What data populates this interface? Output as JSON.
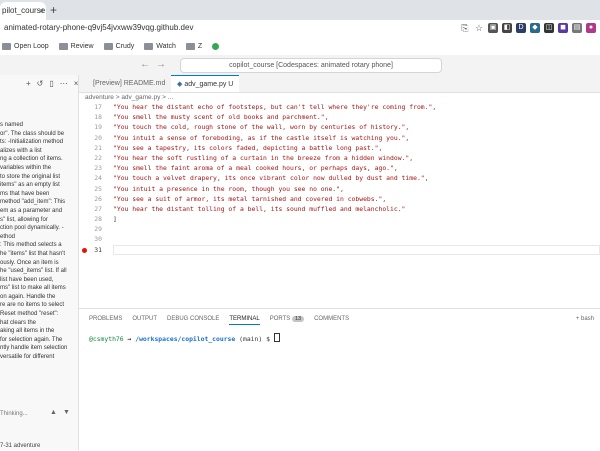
{
  "browser": {
    "tab_title": "pilot_course",
    "url": "animated-rotary-phone-q9vj54jvxww39vqg.github.dev",
    "bookmarks": [
      "Open Loop",
      "Review",
      "Crudy",
      "Watch",
      "Z"
    ]
  },
  "codespace": {
    "title": "copilot_course [Codespaces: animated rotary phone]",
    "tabs": [
      "[Preview] README.md",
      "adv_game.py U"
    ],
    "breadcrumb": "adventure  >  adv_game.py  >  ...",
    "code_lines": [
      {
        "n": "17",
        "text": "\"You hear the distant echo of footsteps, but can't tell where they're coming from.\","
      },
      {
        "n": "18",
        "text": "\"You smell the musty scent of old books and parchment.\","
      },
      {
        "n": "19",
        "text": "\"You touch the cold, rough stone of the wall, worn by centuries of history.\","
      },
      {
        "n": "20",
        "text": "\"You intuit a sense of foreboding, as if the castle itself is watching you.\","
      },
      {
        "n": "21",
        "text": "\"You see a tapestry, its colors faded, depicting a battle long past.\","
      },
      {
        "n": "22",
        "text": "\"You hear the soft rustling of a curtain in the breeze from a hidden window.\","
      },
      {
        "n": "23",
        "text": "\"You smell the faint aroma of a meal cooked hours, or perhaps days, ago.\","
      },
      {
        "n": "24",
        "text": "\"You touch a velvet drapery, its once vibrant color now dulled by dust and time.\","
      },
      {
        "n": "25",
        "text": "\"You intuit a presence in the room, though you see no one.\","
      },
      {
        "n": "26",
        "text": "\"You see a suit of armor, its metal tarnished and covered in cobwebs.\","
      },
      {
        "n": "27",
        "text": "\"You hear the distant tolling of a bell, its sound muffled and melancholic.\""
      },
      {
        "n": "28",
        "text": "]"
      },
      {
        "n": "29",
        "text": ""
      },
      {
        "n": "30",
        "text": ""
      },
      {
        "n": "31",
        "text": ""
      }
    ],
    "panel_tabs": [
      "PROBLEMS",
      "OUTPUT",
      "DEBUG CONSOLE",
      "TERMINAL",
      "PORTS",
      "COMMENTS"
    ],
    "ports_count": "13",
    "panel_right": "bash",
    "terminal": {
      "user": "@csmyth76",
      "arrow": "→",
      "path": "/workspaces/copilot_course",
      "branch": "(main)",
      "prompt": "$"
    }
  },
  "chat_panel": {
    "lines": [
      "s named",
      "or\". The class should be",
      "ts: -Initialization method",
      "alizes with a list",
      "ng a collection of items.",
      "variables within the",
      "to store the original list",
      "items\" as an empty list",
      "ms that have been",
      "method \"add_item\": This",
      "em as a parameter and",
      "s\" list, allowing for",
      "ction pool dynamically. -",
      "ethod",
      ": This method selects a",
      "he \"items\" list that hasn't",
      "ously. Once an item is",
      "he \"used_items\" list. If all",
      "list have been used,",
      "ms\" list to make all items",
      "on again. Handle the",
      "re are no items to select",
      "Reset method \"reset\":",
      "hat clears the",
      "aking all items in the",
      "for selection again. The",
      "ntly handle item selection",
      "versatile for different"
    ],
    "status": "Thinking...",
    "bottom": "7-31 adventure"
  }
}
